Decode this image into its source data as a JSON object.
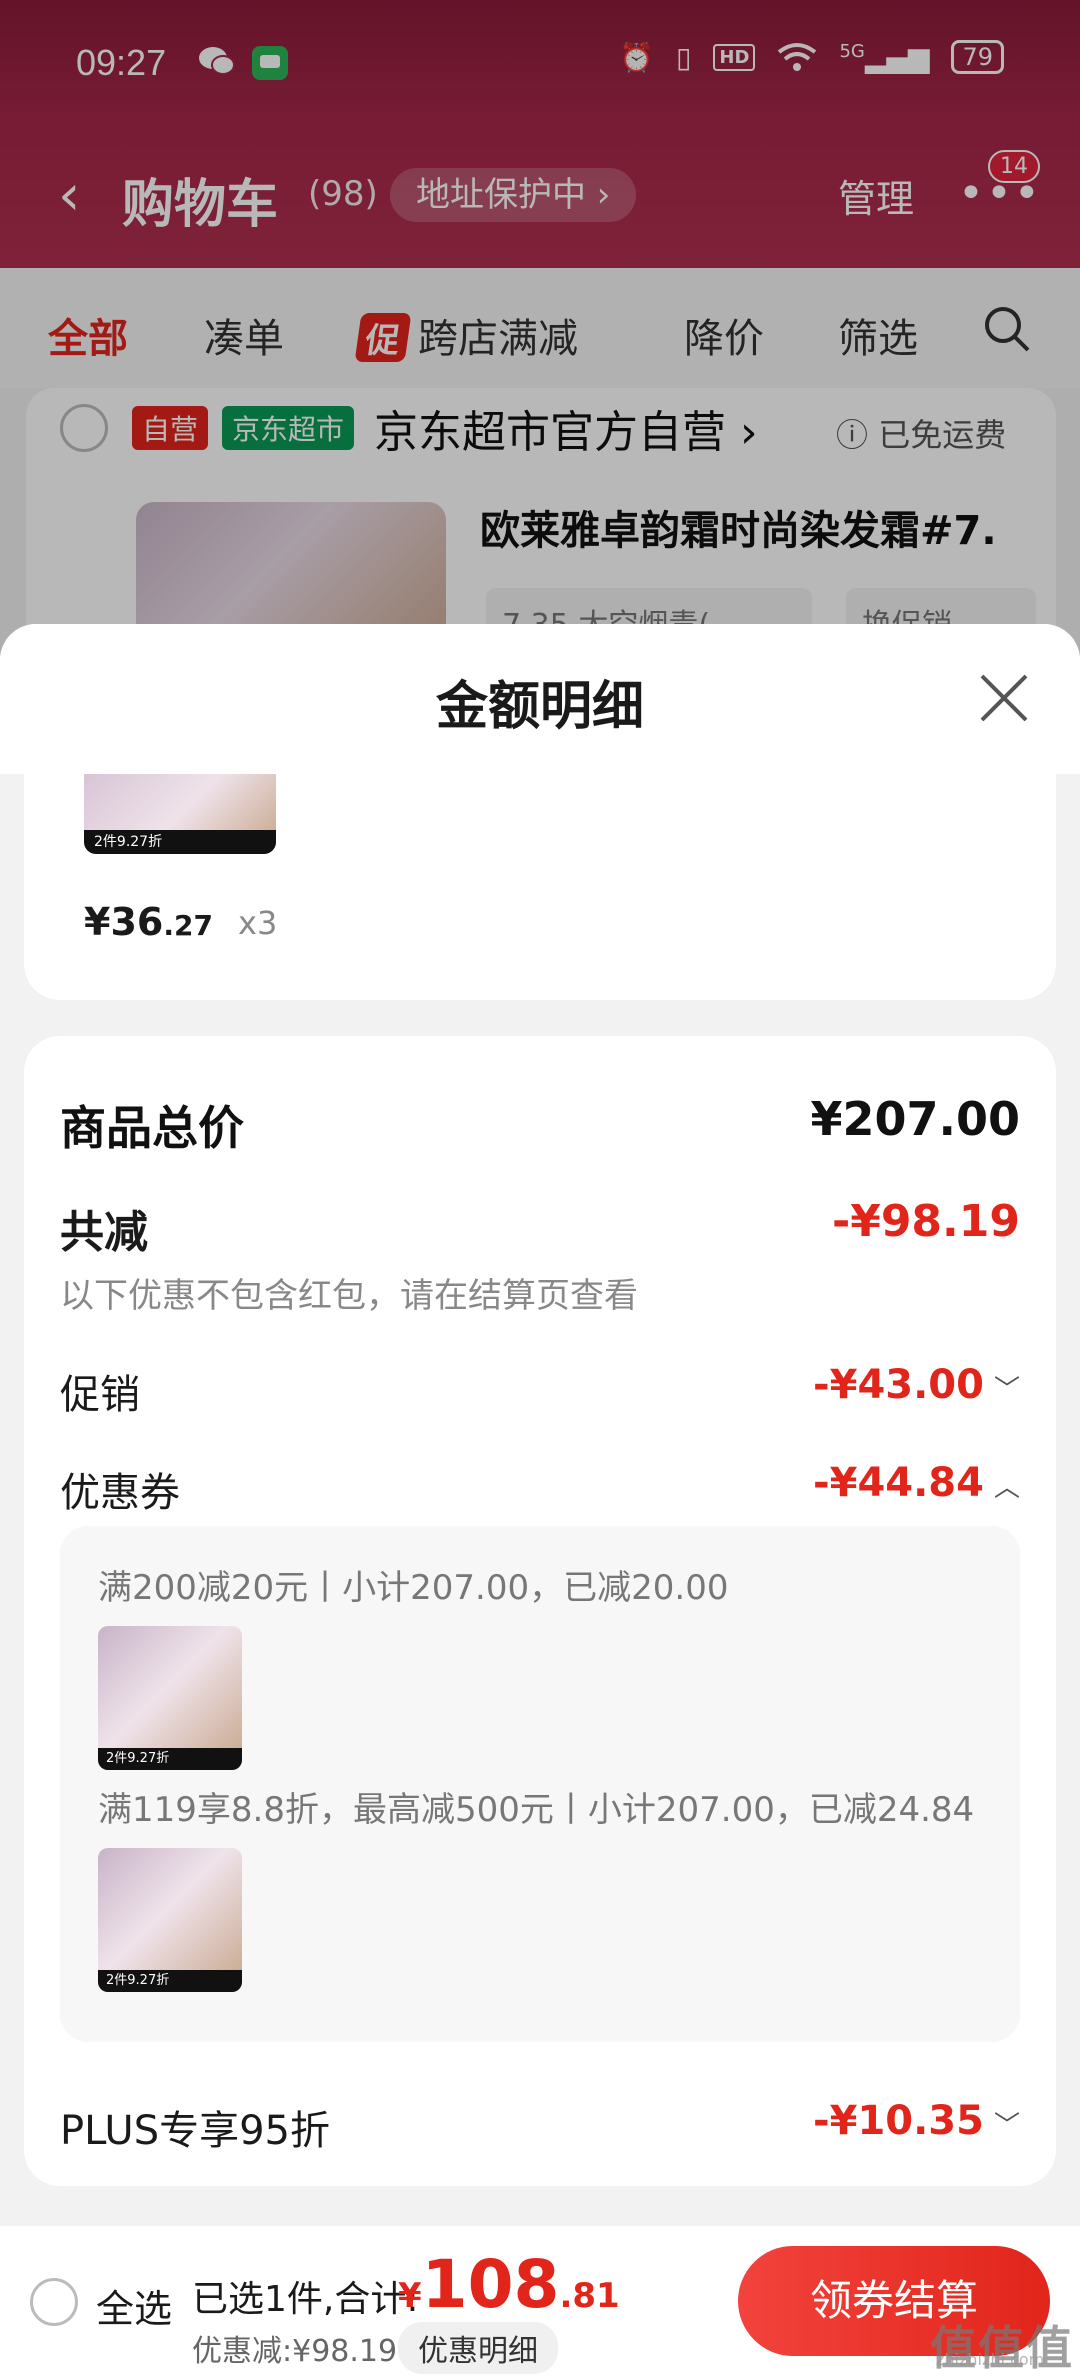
{
  "status_bar": {
    "time": "09:27",
    "hd": "HD",
    "network": "5G",
    "battery": "79"
  },
  "nav": {
    "title": "购物车",
    "count": "(98)",
    "address_protect": "地址保护中 ›",
    "manage": "管理",
    "more_badge": "14"
  },
  "tabs": [
    {
      "label": "全部"
    },
    {
      "label": "凑单"
    },
    {
      "label": "跨店满减",
      "tag": "促"
    },
    {
      "label": "降价"
    },
    {
      "label": "筛选"
    }
  ],
  "shop": {
    "tag_self": "自营",
    "tag_market": "京东超市",
    "name": "京东超市官方自营",
    "shipping": "已免运费",
    "product_title": "欧莱雅卓韵霜时尚染发霜#7.",
    "sku": "7.35 太空烟青(",
    "promo": "换促销"
  },
  "sheet": {
    "title": "金额明细",
    "item": {
      "price_int": "¥36",
      "price_dec": ".27",
      "qty": "x3",
      "thumb_text": "2件9.27折"
    },
    "total_label": "商品总价",
    "total_value": "¥207.00",
    "reduce_label": "共减",
    "reduce_value": "-¥98.19",
    "note": "以下优惠不包含红包，请在结算页查看",
    "promo_label": "促销",
    "promo_value": "-¥43.00",
    "coupon_label": "优惠券",
    "coupon_value": "-¥44.84",
    "coupon_lines": [
      "满200减20元丨小计207.00，已减20.00",
      "满119享8.8折，最高减500元丨小计207.00，已减24.84"
    ],
    "coupon_thumb_text": "2件9.27折",
    "plus_label": "PLUS专享95折",
    "plus_value": "-¥10.35"
  },
  "bottom": {
    "select_all": "全选",
    "selected": "已选1件,合计:",
    "currency": "¥",
    "amount_int": "108",
    "amount_dec": ".81",
    "discount": "优惠减:¥98.19",
    "detail_button": "优惠明细",
    "checkout": "领券结算"
  },
  "watermark": {
    "logo": "值值值",
    "site": "zhizhizhi.com"
  },
  "colors": {
    "accent": "#e1251b",
    "jd_green": "#0a9a57",
    "header": "#a52749"
  }
}
